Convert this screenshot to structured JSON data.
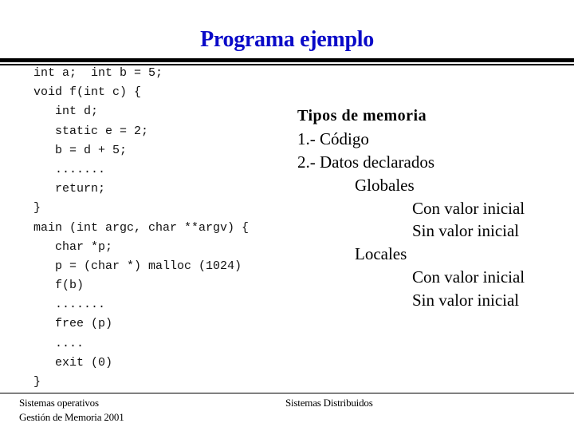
{
  "title": "Programa ejemplo",
  "colors": {
    "title": "#0a0ac8",
    "text": "#000000",
    "background": "#ffffff"
  },
  "code": {
    "lines": [
      {
        "text": "int a;  int b = 5;",
        "indent": 0
      },
      {
        "text": "void f(int c) {",
        "indent": 0
      },
      {
        "text": "int d;",
        "indent": 1
      },
      {
        "text": "static e = 2;",
        "indent": 1
      },
      {
        "text": "b = d + 5;",
        "indent": 1
      },
      {
        "text": ".......",
        "indent": 1
      },
      {
        "text": "return;",
        "indent": 1
      },
      {
        "text": "}",
        "indent": 0
      },
      {
        "text": "main (int argc, char **argv) {",
        "indent": 0
      },
      {
        "text": "char *p;",
        "indent": 1
      },
      {
        "text": "p = (char *) malloc (1024)",
        "indent": 1
      },
      {
        "text": "f(b)",
        "indent": 1
      },
      {
        "text": ".......",
        "indent": 1
      },
      {
        "text": "free (p)",
        "indent": 1
      },
      {
        "text": "....",
        "indent": 1
      },
      {
        "text": "exit (0)",
        "indent": 1
      },
      {
        "text": "}",
        "indent": 0
      }
    ]
  },
  "memory_types": {
    "heading": "Tipos de memoria",
    "items": [
      {
        "text": "1.- Código",
        "level": 0
      },
      {
        "text": "2.- Datos declarados",
        "level": 0
      },
      {
        "text": "Globales",
        "level": 1
      },
      {
        "text": "Con valor inicial",
        "level": 2
      },
      {
        "text": "Sin valor inicial",
        "level": 2
      },
      {
        "text": "Locales",
        "level": 1
      },
      {
        "text": "Con valor inicial",
        "level": 2
      },
      {
        "text": "Sin valor inicial",
        "level": 2
      }
    ]
  },
  "footer": {
    "left_line1": "Sistemas operativos",
    "left_line2": "Gestión de Memoria 2001",
    "center": "Sistemas Distribuidos"
  }
}
